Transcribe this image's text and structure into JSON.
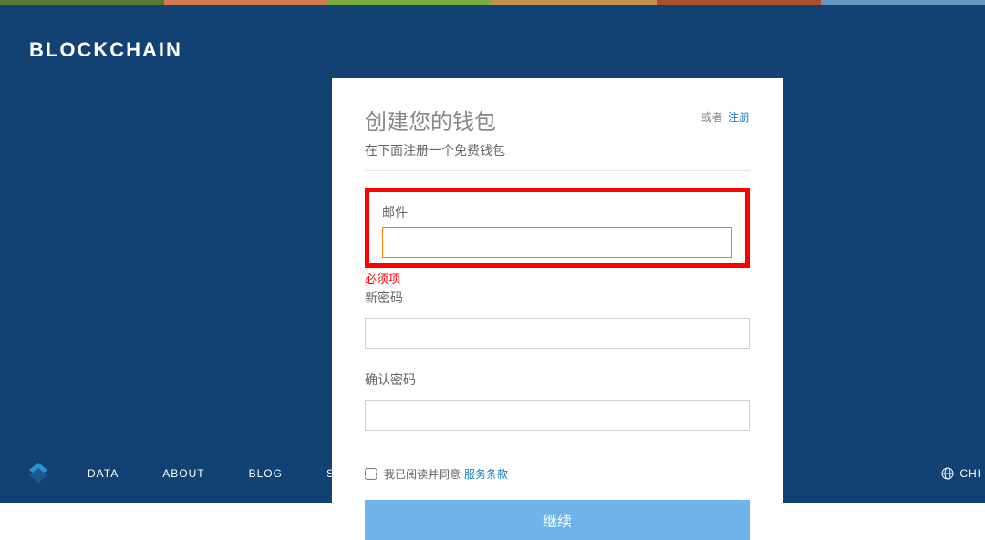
{
  "brand": "BLOCKCHAIN",
  "form": {
    "title": "创建您的钱包",
    "subtitle": "在下面注册一个免费钱包",
    "alt_prefix": "或者",
    "alt_link": "注册",
    "email_label": "邮件",
    "email_value": "",
    "email_error": "必须项",
    "password_label": "新密码",
    "password_value": "",
    "confirm_label": "确认密码",
    "confirm_value": "",
    "agree_text": "我已阅读并同意",
    "terms_link": "服务条款",
    "submit_label": "继续"
  },
  "footer": {
    "items": [
      "DATA",
      "ABOUT",
      "BLOG",
      "SUPPORT"
    ],
    "lang_partial": "CHI"
  }
}
